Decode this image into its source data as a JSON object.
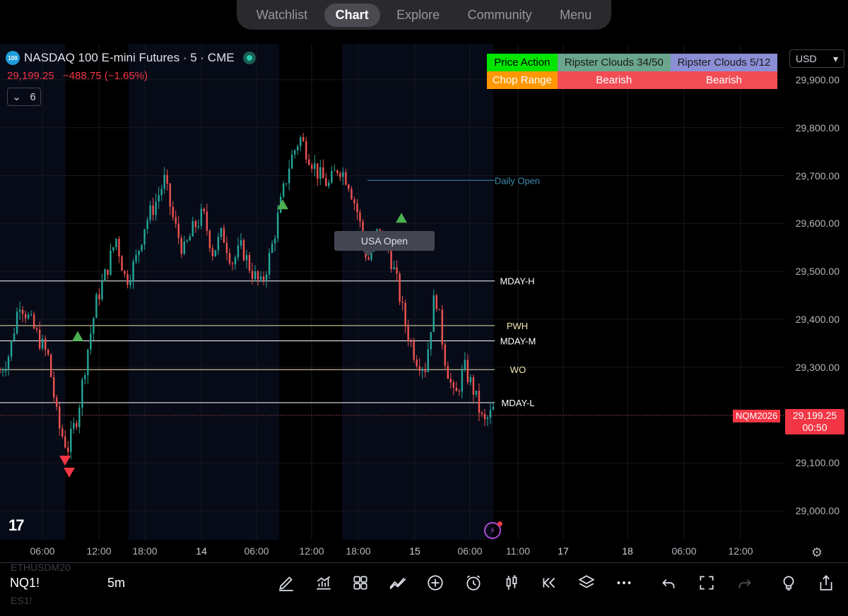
{
  "nav": {
    "tabs": [
      {
        "label": "Watchlist",
        "active": false
      },
      {
        "label": "Chart",
        "active": true
      },
      {
        "label": "Explore",
        "active": false
      },
      {
        "label": "Community",
        "active": false
      },
      {
        "label": "Menu",
        "active": false
      }
    ]
  },
  "legend": {
    "symbol_icon": "100",
    "title": "NASDAQ 100 E-mini Futures · 5 · CME",
    "last_price": "29,199.25",
    "change": "−488.75 (−1.65%)",
    "indicator_count": "6"
  },
  "currency": "USD",
  "indicator_table": {
    "row1": [
      {
        "text": "Price Action",
        "bg": "#00e600",
        "fg": "#000000"
      },
      {
        "text": "Ripster Clouds 34/50",
        "bg": "#6aa58e",
        "fg": "#1a1a1a"
      },
      {
        "text": "Ripster Clouds 5/12",
        "bg": "#8b8fd6",
        "fg": "#1a1a1a"
      }
    ],
    "row2": [
      {
        "text": "Chop Range",
        "bg": "#ff9800",
        "fg": "#ffffff"
      },
      {
        "text": "Bearish",
        "bg": "#f24d55",
        "fg": "#ffffff"
      },
      {
        "text": "Bearish",
        "bg": "#f24d55",
        "fg": "#ffffff"
      }
    ]
  },
  "levels": [
    {
      "label": "Daily Open",
      "price": 29690,
      "color": "#3d8bb0"
    },
    {
      "label": "MDAY-H",
      "price": 29480,
      "color": "#ffffff"
    },
    {
      "label": "PWH",
      "price": 29387,
      "color": "#f0e6b0"
    },
    {
      "label": "MDAY-M",
      "price": 29355,
      "color": "#ffffff"
    },
    {
      "label": "WO",
      "price": 29295,
      "color": "#f0e6b0"
    },
    {
      "label": "MDAY-L",
      "price": 29226,
      "color": "#ffffff"
    }
  ],
  "tooltip": "USA Open",
  "current": {
    "symbol": "NQM2026",
    "price": "29,199.25",
    "countdown": "00:50",
    "value": 29199.25
  },
  "chart_data": {
    "type": "candlestick",
    "ylim": [
      28940,
      29975
    ],
    "y_ticks": [
      {
        "value": 29000,
        "label": "29,000.00"
      },
      {
        "value": 29100,
        "label": "29,100.00"
      },
      {
        "value": 29200,
        "label": "29,200.00"
      },
      {
        "value": 29300,
        "label": "29,300.00"
      },
      {
        "value": 29400,
        "label": "29,400.00"
      },
      {
        "value": 29500,
        "label": "29,500.00"
      },
      {
        "value": 29600,
        "label": "29,600.00"
      },
      {
        "value": 29700,
        "label": "29,700.00"
      },
      {
        "value": 29800,
        "label": "29,800.00"
      },
      {
        "value": 29900,
        "label": "29,900.00"
      }
    ],
    "x_ticks": [
      {
        "label": "06:00",
        "slot": 0
      },
      {
        "label": "12:00",
        "slot": 1
      },
      {
        "label": "18:00",
        "slot": 2
      },
      {
        "label": "14",
        "slot": 3
      },
      {
        "label": "06:00",
        "slot": 4
      },
      {
        "label": "12:00",
        "slot": 5
      },
      {
        "label": "18:00",
        "slot": 6
      },
      {
        "label": "15",
        "slot": 7
      },
      {
        "label": "06:00",
        "slot": 8
      },
      {
        "label": "11:00",
        "slot": 9
      },
      {
        "label": "17",
        "slot": 10
      },
      {
        "label": "18",
        "slot": 11
      },
      {
        "label": "06:00",
        "slot": 12
      },
      {
        "label": "12:00",
        "slot": 13
      }
    ],
    "price_path": [
      29290,
      29330,
      29440,
      29400,
      29360,
      29320,
      29180,
      29130,
      29200,
      29330,
      29440,
      29500,
      29570,
      29480,
      29520,
      29600,
      29640,
      29690,
      29600,
      29540,
      29590,
      29620,
      29540,
      29580,
      29520,
      29550,
      29500,
      29470,
      29540,
      29640,
      29730,
      29780,
      29740,
      29700,
      29680,
      29720,
      29690,
      29620,
      29520,
      29580,
      29560,
      29480,
      29380,
      29320,
      29300,
      29460,
      29320,
      29230,
      29300,
      29250,
      29180,
      29210
    ],
    "signals": [
      {
        "dir": "up",
        "slot": 14,
        "price": 29365
      },
      {
        "dir": "down",
        "slot": 15,
        "price": 29105
      },
      {
        "dir": "down",
        "slot": 16,
        "price": 29080
      },
      {
        "dir": "up",
        "slot": 17,
        "price": 29640
      },
      {
        "dir": "up",
        "slot": 18,
        "price": 29612
      }
    ]
  },
  "bottom": {
    "symbol": "NQ1!",
    "interval": "5m",
    "ghost_top": "ETHUSDM20",
    "ghost_bottom": "ES1!"
  },
  "toolbar_icons": [
    "pencil-icon",
    "indicators-icon",
    "grid-icon",
    "strategy-icon",
    "add-icon",
    "alarm-icon",
    "candles-icon",
    "replay-icon",
    "layers-icon",
    "more-icon",
    "undo-icon",
    "fullscreen-icon",
    "redo-icon",
    "ideas-icon",
    "share-icon"
  ]
}
